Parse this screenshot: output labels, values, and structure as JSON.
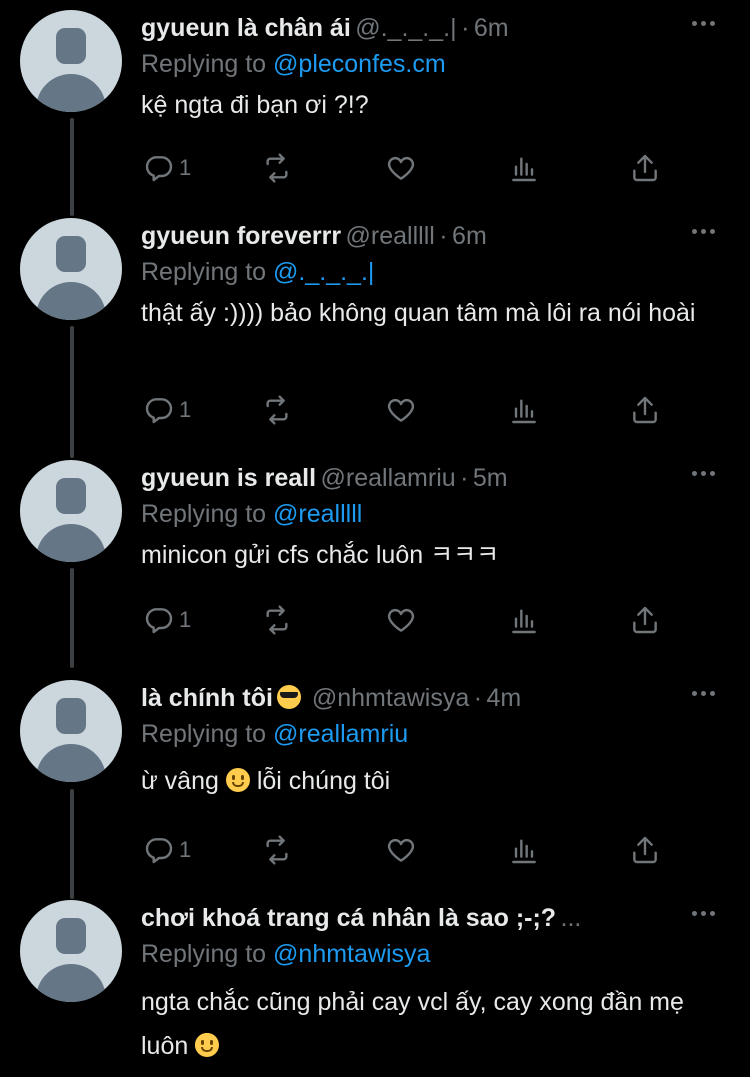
{
  "thread": {
    "tweets": [
      {
        "display_name": "gyueun là chân ái",
        "handle": "@._._._.|",
        "dot": "·",
        "time": "6m",
        "replying_label": "Replying to",
        "replying_to": "@pleconfes.cm",
        "text": "kệ ngta đi bạn ơi ?!?",
        "text_emoji": "",
        "text_after": "",
        "reply_count": "1"
      },
      {
        "display_name": "gyueun foreverrr",
        "handle": "@realllll",
        "dot": "·",
        "time": "6m",
        "replying_label": "Replying to",
        "replying_to": "@._._._.|",
        "text": "thật ấy :)))) bảo không quan tâm mà lôi ra nói hoài",
        "text_emoji": "",
        "text_after": "",
        "reply_count": "1"
      },
      {
        "display_name": "gyueun is reall",
        "handle": "@reallamriu",
        "dot": "·",
        "time": "5m",
        "replying_label": "Replying to",
        "replying_to": "@realllll",
        "text": "minicon gửi cfs chắc luôn ㅋㅋㅋ",
        "text_emoji": "",
        "text_after": "",
        "reply_count": "1"
      },
      {
        "display_name": "là chính tôi",
        "handle": "@nhmtawisya",
        "dot": "·",
        "time": "4m",
        "replying_label": "Replying to",
        "replying_to": "@reallamriu",
        "text": "ừ vâng",
        "text_emoji": "slightly-smiling-face-emoji",
        "text_after": "lỗi chúng tôi",
        "reply_count": "1"
      },
      {
        "display_name": "chơi khoá trang cá nhân là sao ;-;?",
        "handle": "",
        "dot": "",
        "time": "...",
        "replying_label": "Replying to",
        "replying_to": "@nhmtawisya",
        "text": "ngta chắc cũng phải cay vcl ấy, cay xong đần mẹ luôn",
        "text_emoji": "relieved-face-emoji",
        "text_after": "",
        "reply_count": ""
      }
    ],
    "name_emoji_tweet4": "smiling-face-with-sunglasses-emoji",
    "icons": [
      "reply-icon",
      "retweet-icon",
      "like-icon",
      "analytics-icon",
      "share-icon",
      "more-icon"
    ],
    "colors": {
      "background": "#000000",
      "text": "#e7e9ea",
      "muted": "#71767b",
      "link": "#1d9bf0",
      "thread_line": "#3d4146"
    }
  }
}
